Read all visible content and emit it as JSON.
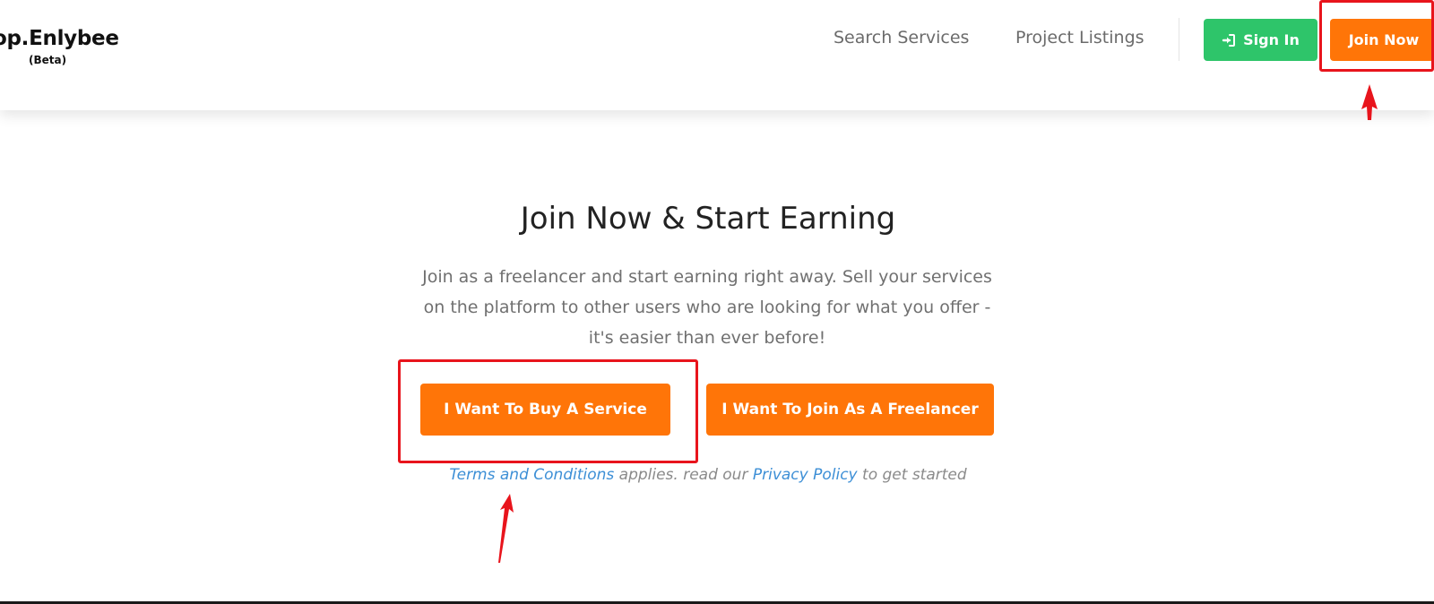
{
  "brand": {
    "name": "op.Enlybee",
    "badge": "(Beta)"
  },
  "nav": {
    "links": [
      {
        "label": "Search Services"
      },
      {
        "label": "Project Listings"
      }
    ],
    "sign_in_label": "Sign In",
    "join_now_label": "Join Now"
  },
  "hero": {
    "title": "Join Now & Start Earning",
    "description": "Join as a freelancer and start earning right away. Sell your services on the platform to other users who are looking for what you offer - it's easier than ever before!",
    "buy_button": "I Want To Buy A Service",
    "freelancer_button": "I Want To Join As A Freelancer",
    "terms": {
      "terms_link": "Terms and Conditions",
      "middle_text": " applies. read our ",
      "privacy_link": "Privacy Policy",
      "end_text": " to get started"
    }
  },
  "colors": {
    "accent_orange": "#ff7508",
    "signin_green": "#2ec56a",
    "link_blue": "#3d8fd6",
    "annotation_red": "#e8141c"
  },
  "icons": {
    "sign_in": "sign-in-icon"
  }
}
